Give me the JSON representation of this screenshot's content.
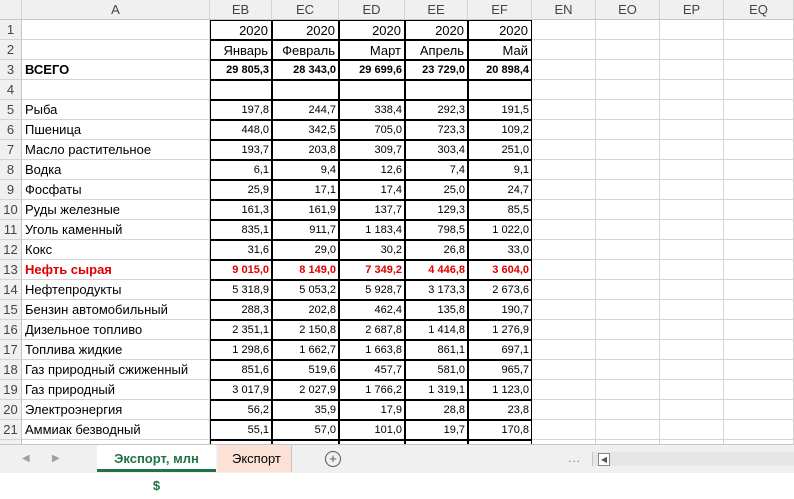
{
  "columns": [
    "A",
    "EB",
    "EC",
    "ED",
    "EE",
    "EF",
    "EN",
    "EO",
    "EP",
    "EQ"
  ],
  "years": [
    "2020",
    "2020",
    "2020",
    "2020",
    "2020"
  ],
  "months": [
    "Январь",
    "Февраль",
    "Март",
    "Апрель",
    "Май"
  ],
  "total": {
    "label": "ВСЕГО",
    "values": [
      "29 805,3",
      "28 343,0",
      "29 699,6",
      "23 729,0",
      "20 898,4"
    ]
  },
  "rows": [
    {
      "n": "5",
      "label": "Рыба",
      "values": [
        "197,8",
        "244,7",
        "338,4",
        "292,3",
        "191,5"
      ]
    },
    {
      "n": "6",
      "label": "Пшеница",
      "values": [
        "448,0",
        "342,5",
        "705,0",
        "723,3",
        "109,2"
      ]
    },
    {
      "n": "7",
      "label": "Масло растительное",
      "values": [
        "193,7",
        "203,8",
        "309,7",
        "303,4",
        "251,0"
      ]
    },
    {
      "n": "8",
      "label": "Водка",
      "values": [
        "6,1",
        "9,4",
        "12,6",
        "7,4",
        "9,1"
      ]
    },
    {
      "n": "9",
      "label": "Фосфаты",
      "values": [
        "25,9",
        "17,1",
        "17,4",
        "25,0",
        "24,7"
      ]
    },
    {
      "n": "10",
      "label": "Руды железные",
      "values": [
        "161,3",
        "161,9",
        "137,7",
        "129,3",
        "85,5"
      ]
    },
    {
      "n": "11",
      "label": "Уголь каменный",
      "values": [
        "835,1",
        "911,7",
        "1 183,4",
        "798,5",
        "1 022,0"
      ]
    },
    {
      "n": "12",
      "label": "Кокс",
      "values": [
        "31,6",
        "29,0",
        "30,2",
        "26,8",
        "33,0"
      ]
    },
    {
      "n": "13",
      "label": "Нефть сырая",
      "values": [
        "9 015,0",
        "8 149,0",
        "7 349,2",
        "4 446,8",
        "3 604,0"
      ],
      "highlight": true
    },
    {
      "n": "14",
      "label": "Нефтепродукты",
      "values": [
        "5 318,9",
        "5 053,2",
        "5 928,7",
        "3 173,3",
        "2 673,6"
      ]
    },
    {
      "n": "15",
      "label": "Бензин автомобильный",
      "values": [
        "288,3",
        "202,8",
        "462,4",
        "135,8",
        "190,7"
      ]
    },
    {
      "n": "16",
      "label": "Дизельное топливо",
      "values": [
        "2 351,1",
        "2 150,8",
        "2 687,8",
        "1 414,8",
        "1 276,9"
      ]
    },
    {
      "n": "17",
      "label": "Топлива жидкие",
      "values": [
        "1 298,6",
        "1 662,7",
        "1 663,8",
        "861,1",
        "697,1"
      ]
    },
    {
      "n": "18",
      "label": "Газ природный сжиженный",
      "values": [
        "851,6",
        "519,6",
        "457,7",
        "581,0",
        "965,7"
      ]
    },
    {
      "n": "19",
      "label": "Газ природный",
      "values": [
        "3 017,9",
        "2 027,9",
        "1 766,2",
        "1 319,1",
        "1 123,0"
      ]
    },
    {
      "n": "20",
      "label": "Электроэнергия",
      "values": [
        "56,2",
        "35,9",
        "17,9",
        "28,8",
        "23,8"
      ]
    },
    {
      "n": "21",
      "label": "Аммиак безводный",
      "values": [
        "55,1",
        "57,0",
        "101,0",
        "19,7",
        "170,8"
      ]
    }
  ],
  "tabs": {
    "active": "Экспорт, млн $",
    "other": "Экспорт"
  },
  "ui": {
    "add_sheet": "+",
    "nav_prev": "◀",
    "nav_next": "▶",
    "dots": "...",
    "scroll_left": "◀"
  }
}
